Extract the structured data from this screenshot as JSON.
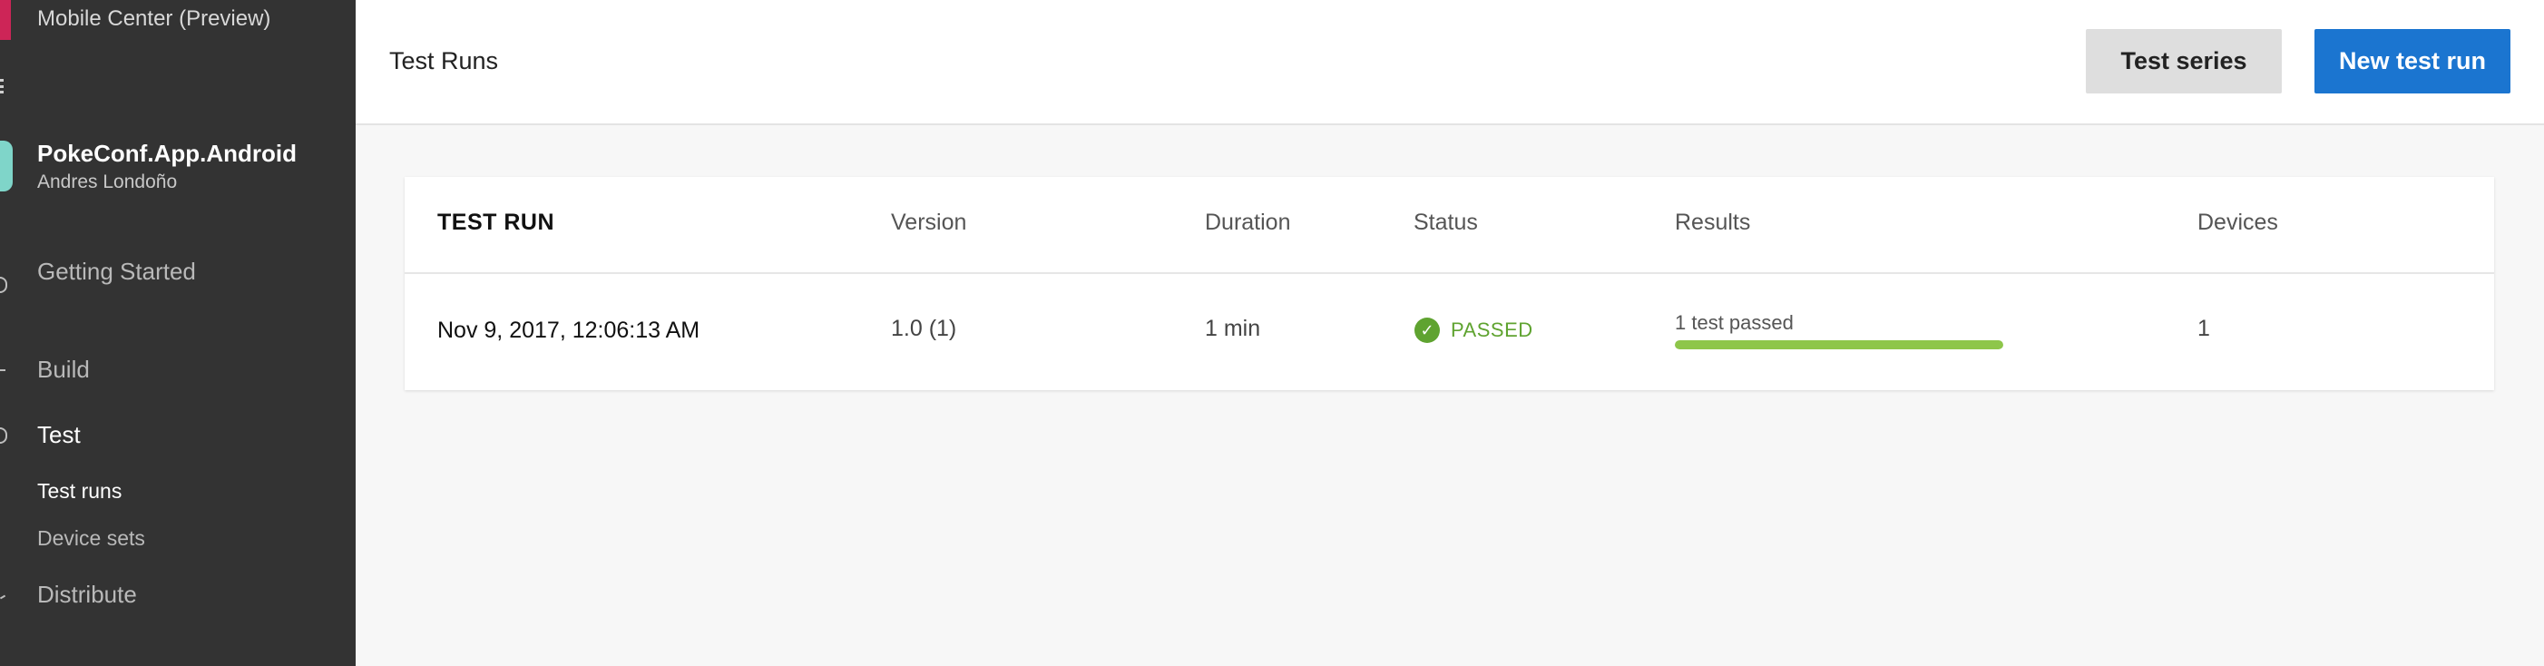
{
  "sidebar": {
    "brand_title": "Mobile Center (Preview)",
    "brand_color": "#cd2557",
    "app": {
      "name": "PokeConf.App.Android",
      "owner": "Andres Londoño",
      "icon_color": "#7fd5c9"
    },
    "nav": {
      "getting_started": "Getting Started",
      "build": "Build",
      "test": "Test",
      "test_sub": {
        "test_runs": "Test runs",
        "device_sets": "Device sets"
      },
      "distribute": "Distribute"
    }
  },
  "header": {
    "title": "Test Runs",
    "test_series_label": "Test series",
    "new_test_run_label": "New test run",
    "primary_color": "#1b75d0"
  },
  "table": {
    "columns": {
      "test_run": "TEST RUN",
      "version": "Version",
      "duration": "Duration",
      "status": "Status",
      "results": "Results",
      "devices": "Devices"
    },
    "rows": [
      {
        "test_run": "Nov 9, 2017, 12:06:13 AM",
        "version": "1.0 (1)",
        "duration": "1 min",
        "status": "PASSED",
        "status_icon": "check-circle-icon",
        "status_color": "#5fa330",
        "results_text": "1 test passed",
        "results_progress": 1.0,
        "results_color": "#8ec64a",
        "devices": "1"
      }
    ]
  }
}
